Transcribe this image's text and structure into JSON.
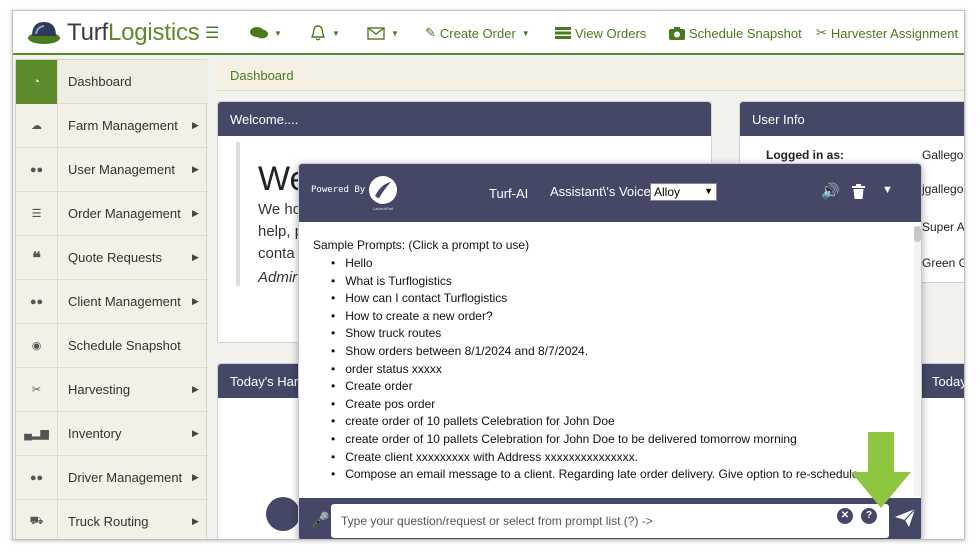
{
  "app": {
    "logo_part1": "Turf",
    "logo_part2": "Logistics"
  },
  "topnav": {
    "create_order": "Create Order",
    "view_orders": "View Orders",
    "schedule_snapshot": "Schedule Snapshot",
    "harvester_assignment": "Harvester Assignment"
  },
  "sidebar": {
    "items": [
      {
        "label": "Dashboard",
        "icon": "dashboard-icon"
      },
      {
        "label": "Farm Management",
        "icon": "cloud-icon"
      },
      {
        "label": "User Management",
        "icon": "users-icon"
      },
      {
        "label": "Order Management",
        "icon": "list-icon"
      },
      {
        "label": "Quote Requests",
        "icon": "quote-icon"
      },
      {
        "label": "Client Management",
        "icon": "users-icon"
      },
      {
        "label": "Schedule Snapshot",
        "icon": "camera-icon"
      },
      {
        "label": "Harvesting",
        "icon": "scissors-icon"
      },
      {
        "label": "Inventory",
        "icon": "bar-chart-icon"
      },
      {
        "label": "Driver Management",
        "icon": "users-icon"
      },
      {
        "label": "Truck Routing",
        "icon": "truck-icon"
      }
    ]
  },
  "breadcrumb": "Dashboard",
  "welcome": {
    "title": "Welcome....",
    "big_text": "We",
    "line1": "We ho",
    "line2": "help, p",
    "line3": "conta",
    "admin": "Admir"
  },
  "user_info": {
    "title": "User Info",
    "logged_in_label": "Logged in as:",
    "v1": "Gallego,",
    "v2": "jgallegos",
    "v3": "Super Ad",
    "v4": "Green G"
  },
  "today_left": "Today's Harv",
  "today_right": "Today's",
  "chat": {
    "powered_by": "Powered By",
    "brand_sub": "LaunchPad",
    "title": "Turf-AI",
    "voice_label": "Assistant\\'s Voice:",
    "voice_value": "Alloy",
    "prompts_title": "Sample Prompts: (Click a prompt to use)",
    "prompts": [
      "Hello",
      "What is Turflogistics",
      "How can I contact Turflogistics",
      "How to create a new order?",
      "Show truck routes",
      "Show orders between 8/1/2024 and 8/7/2024.",
      "order status xxxxx",
      "Create order",
      "Create pos order",
      "create order of 10 pallets Celebration for John Doe",
      "create order of 10 pallets Celebration for John Doe to be delivered tomorrow morning",
      "Create client xxxxxxxxx with Address xxxxxxxxxxxxxxx.",
      "Compose an email message to a client. Regarding late order delivery. Give option to re-schedule"
    ],
    "input_placeholder": "Type your question/request or select from prompt list (?) ->"
  },
  "colors": {
    "brand_green": "#5d8a2a",
    "navy": "#444866",
    "arrow_green": "#8dc63f"
  }
}
